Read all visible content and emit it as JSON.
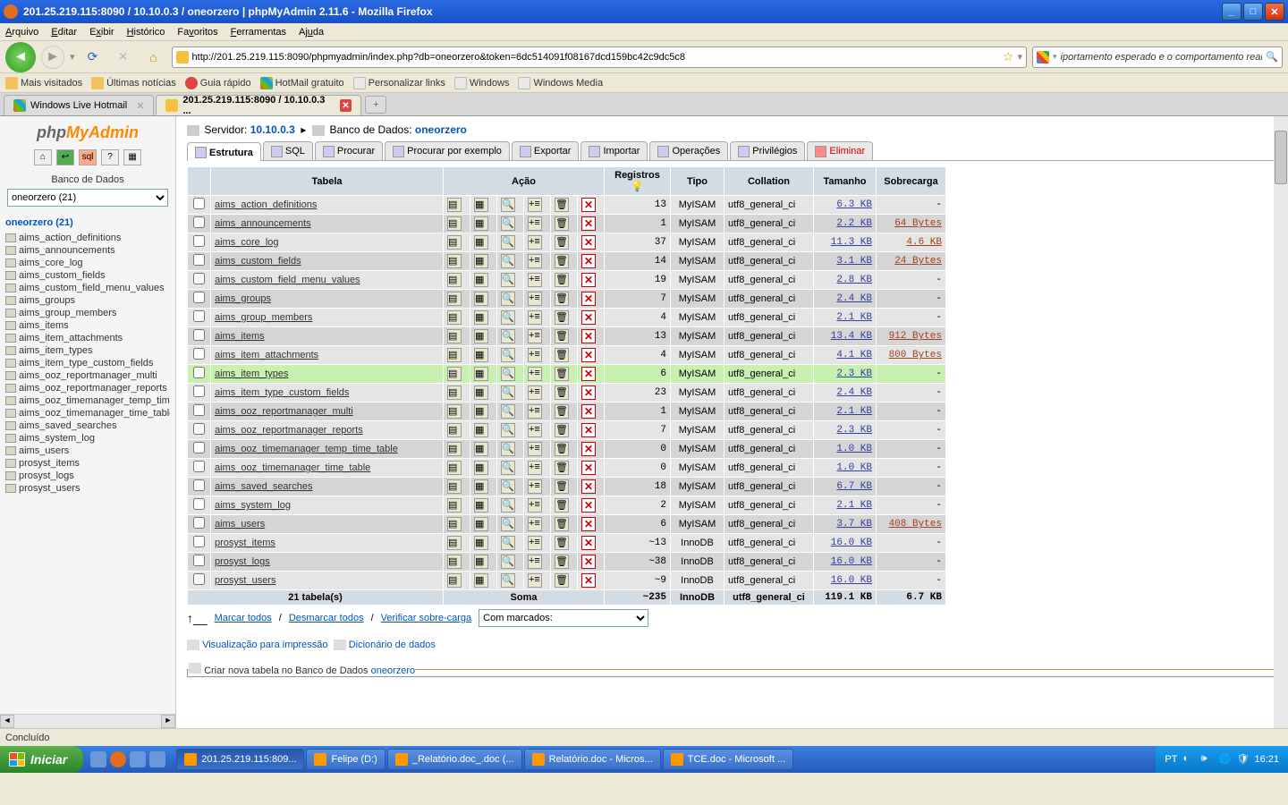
{
  "window": {
    "title": "201.25.219.115:8090 / 10.10.0.3 / oneorzero | phpMyAdmin 2.11.6 - Mozilla Firefox"
  },
  "menubar": [
    "Arquivo",
    "Editar",
    "Exibir",
    "Histórico",
    "Favoritos",
    "Ferramentas",
    "Ajuda"
  ],
  "url": "http://201.25.219.115:8090/phpmyadmin/index.php?db=oneorzero&token=6dc514091f08167dcd159bc42c9dc5c8",
  "search_placeholder": "iportamento esperado e o comportamento real.\"",
  "bookmarks": [
    "Mais visitados",
    "Últimas notícias",
    "Guia rápido",
    "HotMail gratuito",
    "Personalizar links",
    "Windows",
    "Windows Media"
  ],
  "tabs": [
    {
      "label": "Windows Live Hotmail",
      "active": false
    },
    {
      "label": "201.25.219.115:8090 / 10.10.0.3 ...",
      "active": true
    }
  ],
  "sidebar": {
    "db_label": "Banco de Dados",
    "db_select": "oneorzero (21)",
    "db_head": "oneorzero (21)",
    "tables": [
      "aims_action_definitions",
      "aims_announcements",
      "aims_core_log",
      "aims_custom_fields",
      "aims_custom_field_menu_values",
      "aims_groups",
      "aims_group_members",
      "aims_items",
      "aims_item_attachments",
      "aims_item_types",
      "aims_item_type_custom_fields",
      "aims_ooz_reportmanager_multi",
      "aims_ooz_reportmanager_reports",
      "aims_ooz_timemanager_temp_time_ta",
      "aims_ooz_timemanager_time_table",
      "aims_saved_searches",
      "aims_system_log",
      "aims_users",
      "prosyst_items",
      "prosyst_logs",
      "prosyst_users"
    ]
  },
  "breadcrumb": {
    "server_label": "Servidor:",
    "server": "10.10.0.3",
    "db_label": "Banco de Dados:",
    "db": "oneorzero"
  },
  "page_tabs": [
    {
      "label": "Estrutura",
      "active": true
    },
    {
      "label": "SQL"
    },
    {
      "label": "Procurar"
    },
    {
      "label": "Procurar por exemplo"
    },
    {
      "label": "Exportar"
    },
    {
      "label": "Importar"
    },
    {
      "label": "Operações"
    },
    {
      "label": "Privilégios"
    },
    {
      "label": "Eliminar",
      "del": true
    }
  ],
  "columns": [
    "Tabela",
    "Ação",
    "Registros",
    "Tipo",
    "Collation",
    "Tamanho",
    "Sobrecarga"
  ],
  "rows": [
    {
      "name": "aims_action_definitions",
      "rec": "13",
      "type": "MyISAM",
      "coll": "utf8_general_ci",
      "size": "6.3 KB",
      "over": "-"
    },
    {
      "name": "aims_announcements",
      "rec": "1",
      "type": "MyISAM",
      "coll": "utf8_general_ci",
      "size": "2.2 KB",
      "over": "64 Bytes"
    },
    {
      "name": "aims_core_log",
      "rec": "37",
      "type": "MyISAM",
      "coll": "utf8_general_ci",
      "size": "11.3 KB",
      "over": "4.6 KB"
    },
    {
      "name": "aims_custom_fields",
      "rec": "14",
      "type": "MyISAM",
      "coll": "utf8_general_ci",
      "size": "3.1 KB",
      "over": "24 Bytes"
    },
    {
      "name": "aims_custom_field_menu_values",
      "rec": "19",
      "type": "MyISAM",
      "coll": "utf8_general_ci",
      "size": "2.8 KB",
      "over": "-"
    },
    {
      "name": "aims_groups",
      "rec": "7",
      "type": "MyISAM",
      "coll": "utf8_general_ci",
      "size": "2.4 KB",
      "over": "-"
    },
    {
      "name": "aims_group_members",
      "rec": "4",
      "type": "MyISAM",
      "coll": "utf8_general_ci",
      "size": "2.1 KB",
      "over": "-"
    },
    {
      "name": "aims_items",
      "rec": "13",
      "type": "MyISAM",
      "coll": "utf8_general_ci",
      "size": "13.4 KB",
      "over": "912 Bytes"
    },
    {
      "name": "aims_item_attachments",
      "rec": "4",
      "type": "MyISAM",
      "coll": "utf8_general_ci",
      "size": "4.1 KB",
      "over": "800 Bytes"
    },
    {
      "name": "aims_item_types",
      "rec": "6",
      "type": "MyISAM",
      "coll": "utf8_general_ci",
      "size": "2.3 KB",
      "over": "-",
      "hilite": true
    },
    {
      "name": "aims_item_type_custom_fields",
      "rec": "23",
      "type": "MyISAM",
      "coll": "utf8_general_ci",
      "size": "2.4 KB",
      "over": "-"
    },
    {
      "name": "aims_ooz_reportmanager_multi",
      "rec": "1",
      "type": "MyISAM",
      "coll": "utf8_general_ci",
      "size": "2.1 KB",
      "over": "-"
    },
    {
      "name": "aims_ooz_reportmanager_reports",
      "rec": "7",
      "type": "MyISAM",
      "coll": "utf8_general_ci",
      "size": "2.3 KB",
      "over": "-"
    },
    {
      "name": "aims_ooz_timemanager_temp_time_table",
      "rec": "0",
      "type": "MyISAM",
      "coll": "utf8_general_ci",
      "size": "1.0 KB",
      "over": "-"
    },
    {
      "name": "aims_ooz_timemanager_time_table",
      "rec": "0",
      "type": "MyISAM",
      "coll": "utf8_general_ci",
      "size": "1.0 KB",
      "over": "-"
    },
    {
      "name": "aims_saved_searches",
      "rec": "18",
      "type": "MyISAM",
      "coll": "utf8_general_ci",
      "size": "6.7 KB",
      "over": "-"
    },
    {
      "name": "aims_system_log",
      "rec": "2",
      "type": "MyISAM",
      "coll": "utf8_general_ci",
      "size": "2.1 KB",
      "over": "-"
    },
    {
      "name": "aims_users",
      "rec": "6",
      "type": "MyISAM",
      "coll": "utf8_general_ci",
      "size": "3.7 KB",
      "over": "408 Bytes"
    },
    {
      "name": "prosyst_items",
      "rec": "~13",
      "type": "InnoDB",
      "coll": "utf8_general_ci",
      "size": "16.0 KB",
      "over": "-"
    },
    {
      "name": "prosyst_logs",
      "rec": "~38",
      "type": "InnoDB",
      "coll": "utf8_general_ci",
      "size": "16.0 KB",
      "over": "-"
    },
    {
      "name": "prosyst_users",
      "rec": "~9",
      "type": "InnoDB",
      "coll": "utf8_general_ci",
      "size": "16.0 KB",
      "over": "-"
    }
  ],
  "totals": {
    "label": "21 tabela(s)",
    "sum": "Soma",
    "rec": "~235",
    "type": "InnoDB",
    "coll": "utf8_general_ci",
    "size": "119.1 KB",
    "over": "6.7 KB"
  },
  "footer": {
    "check_all": "Marcar todos",
    "uncheck_all": "Desmarcar todos",
    "verify": "Verificar sobre-carga",
    "with_selected": "Com marcados:"
  },
  "print": {
    "print": "Visualização para impressão",
    "dict": "Dicionário de dados"
  },
  "newtable": {
    "prefix": "Criar nova tabela no Banco de Dados",
    "db": "oneorzero"
  },
  "status": "Concluído",
  "taskbar": {
    "start": "Iniciar",
    "tasks": [
      "201.25.219.115:809...",
      "Felipe (D:)",
      "_Relatório.doc_.doc (...",
      "Relatório.doc - Micros...",
      "TCE.doc - Microsoft ..."
    ],
    "lang": "PT",
    "clock": "16:21"
  }
}
